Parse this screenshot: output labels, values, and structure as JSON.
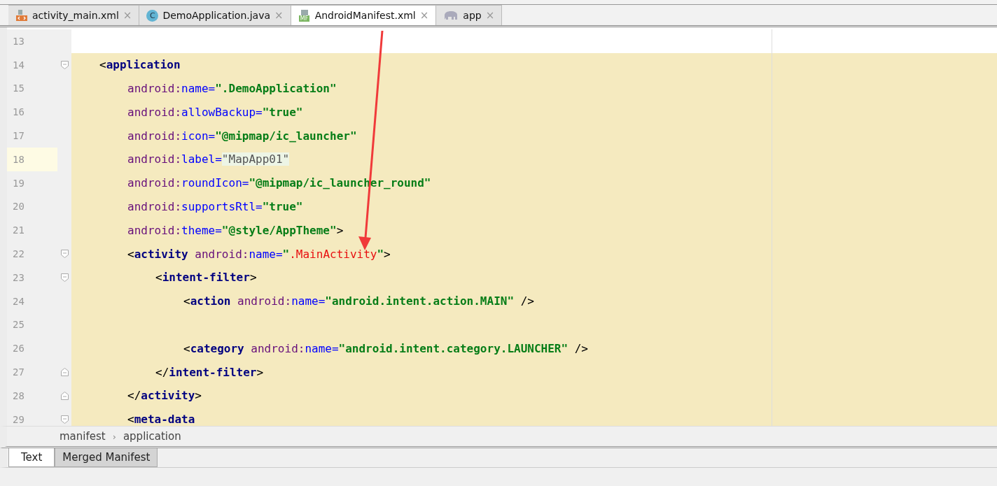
{
  "tabs": [
    {
      "label": "activity_main.xml",
      "kind": "xml",
      "selected": false,
      "close": "×"
    },
    {
      "label": "DemoApplication.java",
      "kind": "java",
      "icon_text": "C",
      "selected": false,
      "close": "×"
    },
    {
      "label": "AndroidManifest.xml",
      "kind": "manifest",
      "icon_text": "MF",
      "selected": true,
      "close": "×"
    },
    {
      "label": "app",
      "kind": "gradle",
      "selected": false,
      "close": "×"
    }
  ],
  "editor": {
    "lines": [
      {
        "number": "13",
        "highlighted": false,
        "current": false
      },
      {
        "number": "14",
        "highlighted": true,
        "current": false,
        "kind": "opener",
        "tokens": [
          {
            "kind": "punct",
            "text": "<"
          },
          {
            "kind": "tag",
            "text": "application"
          }
        ],
        "children": [
          {
            "number": "15",
            "highlighted": true,
            "current": false,
            "tokens": [
              {
                "kind": "ns",
                "text": "android:"
              },
              {
                "kind": "attr",
                "text": "name="
              },
              {
                "kind": "str",
                "text": "\".DemoApplication\""
              }
            ]
          },
          {
            "number": "16",
            "highlighted": true,
            "current": false,
            "tokens": [
              {
                "kind": "ns",
                "text": "android:"
              },
              {
                "kind": "attr",
                "text": "allowBackup="
              },
              {
                "kind": "str",
                "text": "\"true\""
              }
            ]
          },
          {
            "number": "17",
            "highlighted": true,
            "current": false,
            "tokens": [
              {
                "kind": "ns",
                "text": "android:"
              },
              {
                "kind": "attr",
                "text": "icon="
              },
              {
                "kind": "str",
                "text": "\"@mipmap/ic_launcher\""
              }
            ]
          },
          {
            "number": "18",
            "highlighted": true,
            "current": true,
            "tokens": [
              {
                "kind": "ns",
                "text": "android:"
              },
              {
                "kind": "attr",
                "text": "label="
              },
              {
                "kind": "folded",
                "text": "\"MapApp01\""
              }
            ]
          },
          {
            "number": "19",
            "highlighted": true,
            "current": false,
            "tokens": [
              {
                "kind": "ns",
                "text": "android:"
              },
              {
                "kind": "attr",
                "text": "roundIcon="
              },
              {
                "kind": "str",
                "text": "\"@mipmap/ic_launcher_round\""
              }
            ]
          },
          {
            "number": "20",
            "highlighted": true,
            "current": false,
            "tokens": [
              {
                "kind": "ns",
                "text": "android:"
              },
              {
                "kind": "attr",
                "text": "supportsRtl="
              },
              {
                "kind": "str",
                "text": "\"true\""
              }
            ]
          },
          {
            "number": "21",
            "highlighted": true,
            "current": false,
            "tokens": [
              {
                "kind": "ns",
                "text": "android:"
              },
              {
                "kind": "attr",
                "text": "theme="
              },
              {
                "kind": "str",
                "text": "\"@style/AppTheme\""
              },
              {
                "kind": "punct",
                "text": ">"
              }
            ]
          },
          {
            "number": "22",
            "highlighted": true,
            "current": false,
            "kind": "opener",
            "tokens": [
              {
                "kind": "punct",
                "text": "<"
              },
              {
                "kind": "tag",
                "text": "activity"
              },
              {
                "kind": "ns",
                "text": " android:"
              },
              {
                "kind": "attr",
                "text": "name="
              },
              {
                "kind": "str",
                "text": "\""
              },
              {
                "kind": "error",
                "text": ".MainActivity"
              },
              {
                "kind": "str",
                "text": "\""
              },
              {
                "kind": "punct",
                "text": ">"
              }
            ],
            "children": [
              {
                "number": "23",
                "highlighted": true,
                "current": false,
                "kind": "opener",
                "tokens": [
                  {
                    "kind": "punct",
                    "text": "<"
                  },
                  {
                    "kind": "tag",
                    "text": "intent-filter"
                  },
                  {
                    "kind": "punct",
                    "text": ">"
                  }
                ],
                "children": [
                  {
                    "number": "24",
                    "highlighted": true,
                    "current": false,
                    "tokens": [
                      {
                        "kind": "punct",
                        "text": "<"
                      },
                      {
                        "kind": "tag",
                        "text": "action"
                      },
                      {
                        "kind": "ns",
                        "text": " android:"
                      },
                      {
                        "kind": "attr",
                        "text": "name="
                      },
                      {
                        "kind": "str",
                        "text": "\"android.intent.action.MAIN\""
                      },
                      {
                        "kind": "punct",
                        "text": " />"
                      }
                    ]
                  },
                  {
                    "number": "25",
                    "highlighted": true,
                    "current": false
                  },
                  {
                    "number": "26",
                    "highlighted": true,
                    "current": false,
                    "tokens": [
                      {
                        "kind": "punct",
                        "text": "<"
                      },
                      {
                        "kind": "tag",
                        "text": "category"
                      },
                      {
                        "kind": "ns",
                        "text": " android:"
                      },
                      {
                        "kind": "attr",
                        "text": "name="
                      },
                      {
                        "kind": "str",
                        "text": "\"android.intent.category.LAUNCHER\""
                      },
                      {
                        "kind": "punct",
                        "text": " />"
                      }
                    ]
                  }
                ]
              },
              {
                "number": "27",
                "highlighted": true,
                "current": false,
                "kind": "closer",
                "tokens": [
                  {
                    "kind": "punct",
                    "text": "</"
                  },
                  {
                    "kind": "tag",
                    "text": "intent-filter"
                  },
                  {
                    "kind": "punct",
                    "text": ">"
                  }
                ]
              }
            ]
          },
          {
            "number": "28",
            "highlighted": true,
            "current": false,
            "kind": "closer",
            "tokens": [
              {
                "kind": "punct",
                "text": "</"
              },
              {
                "kind": "tag",
                "text": "activity"
              },
              {
                "kind": "punct",
                "text": ">"
              }
            ]
          },
          {
            "number": "29",
            "highlighted": true,
            "current": false,
            "kind": "opener",
            "tokens": [
              {
                "kind": "punct",
                "text": "<"
              },
              {
                "kind": "tag",
                "text": "meta-data"
              }
            ]
          }
        ]
      }
    ],
    "annotation": {
      "kind": "arrow"
    }
  },
  "breadcrumb": {
    "items": [
      "manifest",
      "application"
    ],
    "separator": "›"
  },
  "bottom_tabs": [
    {
      "label": "Text",
      "selected": true
    },
    {
      "label": "Merged Manifest",
      "selected": false
    }
  ]
}
